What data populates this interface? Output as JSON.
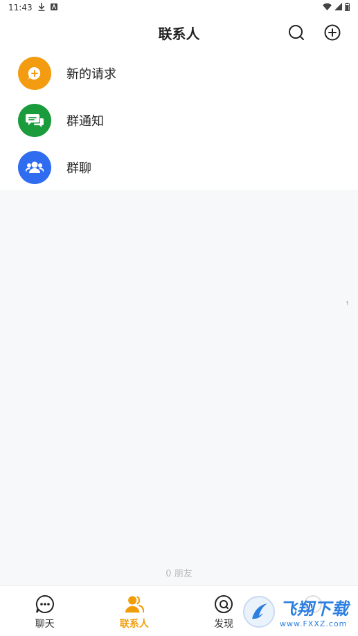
{
  "status_bar": {
    "time": "11:43",
    "icons": [
      "download-icon",
      "notification-icon",
      "wifi-icon",
      "signal-icon",
      "battery-icon"
    ]
  },
  "header": {
    "title": "联系人",
    "search_icon": "search-icon",
    "add_icon": "add-circle-icon"
  },
  "menu": [
    {
      "label": "新的请求",
      "icon": "add-chat-icon",
      "color": "#f39c12"
    },
    {
      "label": "群通知",
      "icon": "chat-bubbles-icon",
      "color": "#1a9b3c"
    },
    {
      "label": "群聊",
      "icon": "group-icon",
      "color": "#2f6cf0"
    }
  ],
  "index_mark": "↑",
  "friend_count": "0 朋友",
  "tabs": [
    {
      "label": "聊天",
      "icon": "chat-icon",
      "active": false
    },
    {
      "label": "联系人",
      "icon": "contacts-icon",
      "active": true
    },
    {
      "label": "发现",
      "icon": "discover-icon",
      "active": false
    }
  ],
  "watermark": {
    "main": "飞翔下载",
    "sub": "www.FXXZ.com"
  },
  "colors": {
    "accent": "#f09d0a",
    "background": "#f7f8fa"
  }
}
